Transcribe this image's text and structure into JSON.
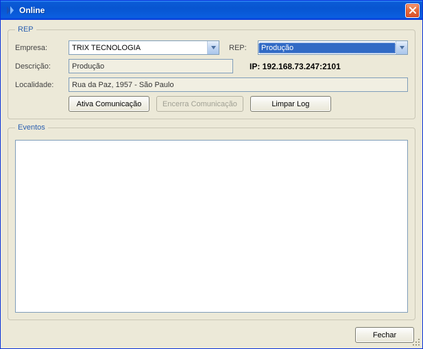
{
  "window": {
    "title": "Online"
  },
  "rep_group": {
    "legend": "REP",
    "empresa_label": "Empresa:",
    "empresa_value": "TRIX TECNOLOGIA",
    "rep_label": "REP:",
    "rep_value": "Produção",
    "descricao_label": "Descrição:",
    "descricao_value": "Produção",
    "ip_label": "IP: 192.168.73.247:2101",
    "localidade_label": "Localidade:",
    "localidade_value": "Rua da Paz, 1957 - São Paulo",
    "btn_ativa": "Ativa Comunicação",
    "btn_encerra": "Encerra Comunicação",
    "btn_limpar": "Limpar Log"
  },
  "eventos": {
    "legend": "Eventos",
    "log": ""
  },
  "footer": {
    "fechar": "Fechar"
  }
}
